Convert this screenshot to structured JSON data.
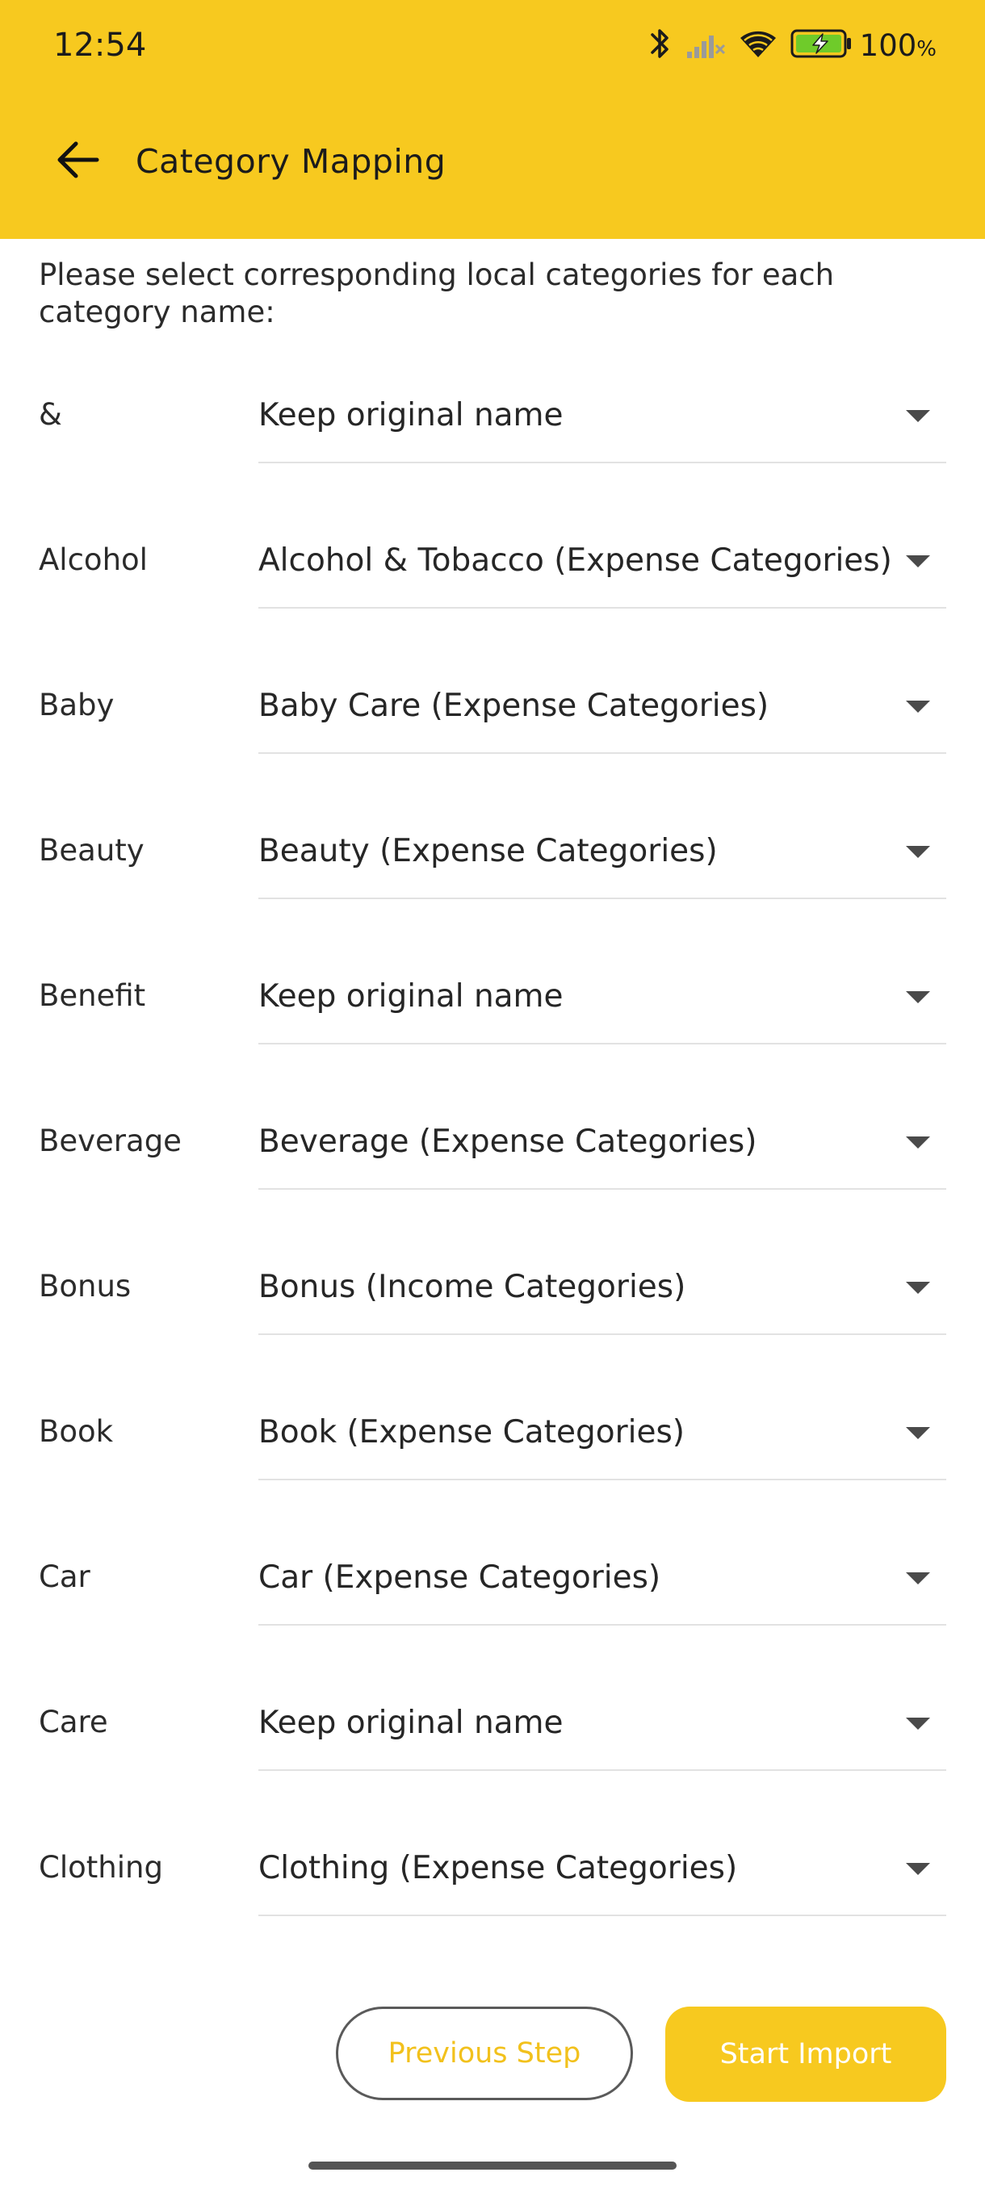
{
  "status_bar": {
    "time": "12:54",
    "battery_percent": "100",
    "battery_percent_sign": "%",
    "icons": [
      "bluetooth-icon",
      "cell-signal-icon",
      "wifi-icon",
      "battery-charging-icon"
    ]
  },
  "header": {
    "title": "Category Mapping",
    "back_icon": "arrow-left-icon"
  },
  "instructions": "Please select corresponding local categories for each category name:",
  "mappings": [
    {
      "name": "&",
      "value": "Keep original name"
    },
    {
      "name": "Alcohol",
      "value": "Alcohol & Tobacco (Expense Categories)"
    },
    {
      "name": "Baby",
      "value": "Baby Care (Expense Categories)"
    },
    {
      "name": "Beauty",
      "value": "Beauty (Expense Categories)"
    },
    {
      "name": "Benefit",
      "value": "Keep original name"
    },
    {
      "name": "Beverage",
      "value": "Beverage (Expense Categories)"
    },
    {
      "name": "Bonus",
      "value": "Bonus (Income Categories)"
    },
    {
      "name": "Book",
      "value": "Book (Expense Categories)"
    },
    {
      "name": "Car",
      "value": "Car (Expense Categories)"
    },
    {
      "name": "Care",
      "value": "Keep original name"
    },
    {
      "name": "Clothing",
      "value": "Clothing (Expense Categories)"
    }
  ],
  "buttons": {
    "previous": "Previous Step",
    "start": "Start Import"
  },
  "colors": {
    "accent": "#F7C91F",
    "background": "#FFFFFF",
    "text": "#222222"
  }
}
